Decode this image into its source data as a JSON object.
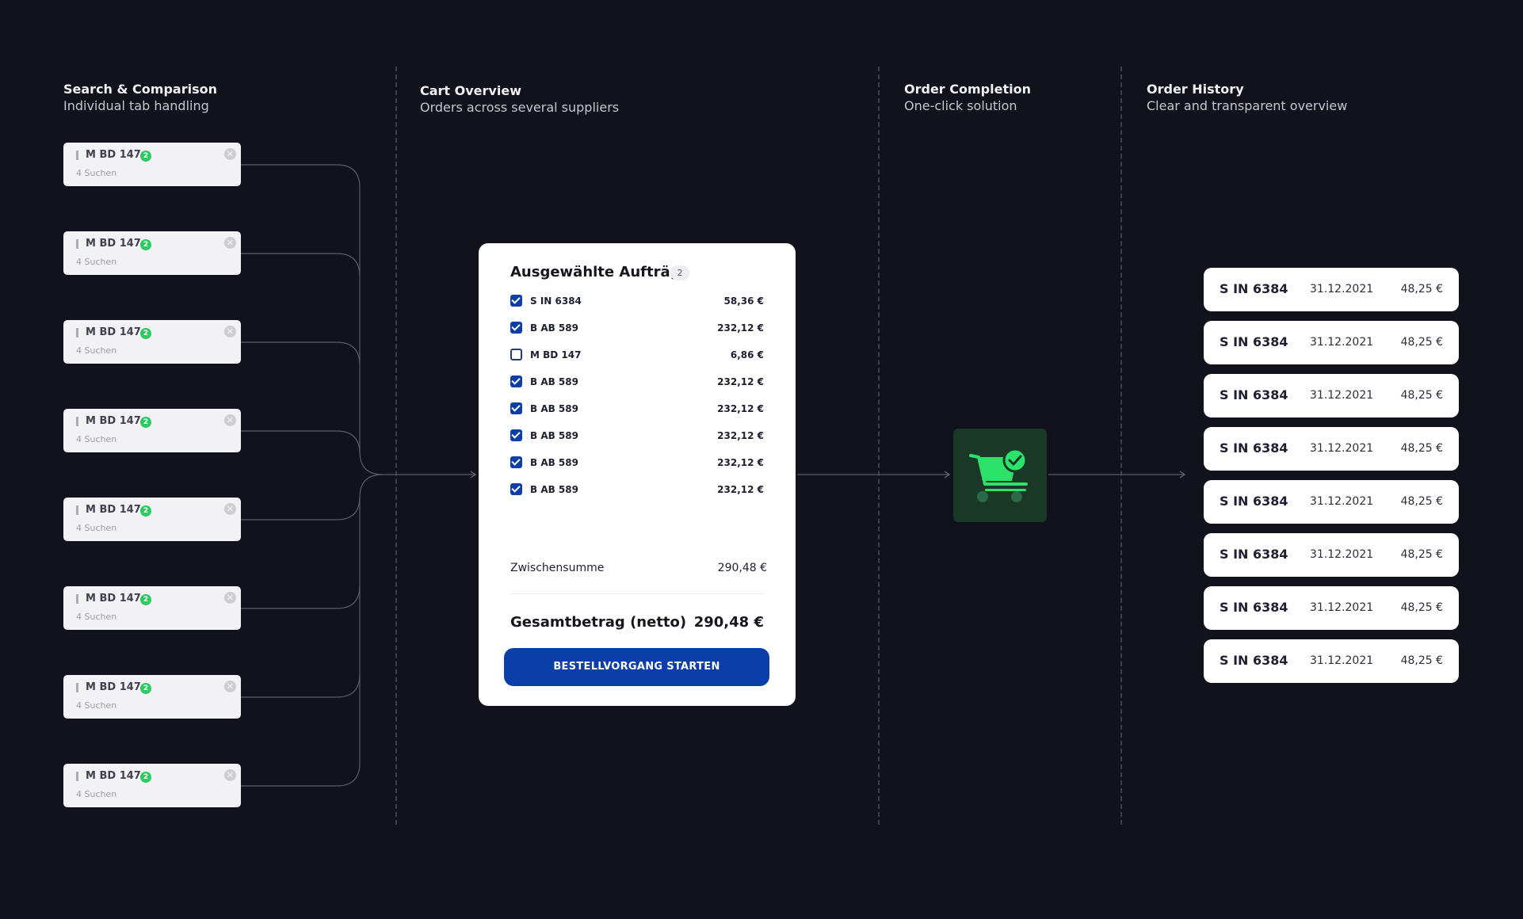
{
  "columns": [
    {
      "title": "Search & Comparison",
      "subtitle": "Individual tab handling"
    },
    {
      "title": "Cart Overview",
      "subtitle": "Orders across several suppliers"
    },
    {
      "title": "Order Completion",
      "subtitle": "One-click solution"
    },
    {
      "title": "Order History",
      "subtitle": "Clear and transparent overview"
    }
  ],
  "search_tabs": [
    {
      "code": "M BD 147",
      "badge": "2",
      "sub": "4 Suchen"
    },
    {
      "code": "M BD 147",
      "badge": "2",
      "sub": "4 Suchen"
    },
    {
      "code": "M BD 147",
      "badge": "2",
      "sub": "4 Suchen"
    },
    {
      "code": "M BD 147",
      "badge": "2",
      "sub": "4 Suchen"
    },
    {
      "code": "M BD 147",
      "badge": "2",
      "sub": "4 Suchen"
    },
    {
      "code": "M BD 147",
      "badge": "2",
      "sub": "4 Suchen"
    },
    {
      "code": "M BD 147",
      "badge": "2",
      "sub": "4 Suchen"
    },
    {
      "code": "M BD 147",
      "badge": "2",
      "sub": "4 Suchen"
    }
  ],
  "cart": {
    "title": "Ausgewählte Aufträge",
    "count": "2",
    "items": [
      {
        "label": "S IN 6384",
        "amount": "58,36 €",
        "checked": true
      },
      {
        "label": "B AB 589",
        "amount": "232,12 €",
        "checked": true
      },
      {
        "label": "M BD 147",
        "amount": "6,86 €",
        "checked": false
      },
      {
        "label": "B AB 589",
        "amount": "232,12 €",
        "checked": true
      },
      {
        "label": "B AB 589",
        "amount": "232,12 €",
        "checked": true
      },
      {
        "label": "B AB 589",
        "amount": "232,12 €",
        "checked": true
      },
      {
        "label": "B AB 589",
        "amount": "232,12 €",
        "checked": true
      },
      {
        "label": "B AB 589",
        "amount": "232,12 €",
        "checked": true
      }
    ],
    "subtotal_label": "Zwischensumme",
    "subtotal": "290,48 €",
    "total_label": "Gesamtbetrag (netto)",
    "total": "290,48 €",
    "cta": "BESTELLVORGANG STARTEN"
  },
  "completion": {
    "icon": "cart-check-icon",
    "color": "#2be36a"
  },
  "history": [
    {
      "code": "S IN 6384",
      "date": "31.12.2021",
      "amount": "48,25 €"
    },
    {
      "code": "S IN 6384",
      "date": "31.12.2021",
      "amount": "48,25 €"
    },
    {
      "code": "S IN 6384",
      "date": "31.12.2021",
      "amount": "48,25 €"
    },
    {
      "code": "S IN 6384",
      "date": "31.12.2021",
      "amount": "48,25 €"
    },
    {
      "code": "S IN 6384",
      "date": "31.12.2021",
      "amount": "48,25 €"
    },
    {
      "code": "S IN 6384",
      "date": "31.12.2021",
      "amount": "48,25 €"
    },
    {
      "code": "S IN 6384",
      "date": "31.12.2021",
      "amount": "48,25 €"
    },
    {
      "code": "S IN 6384",
      "date": "31.12.2021",
      "amount": "48,25 €"
    }
  ]
}
